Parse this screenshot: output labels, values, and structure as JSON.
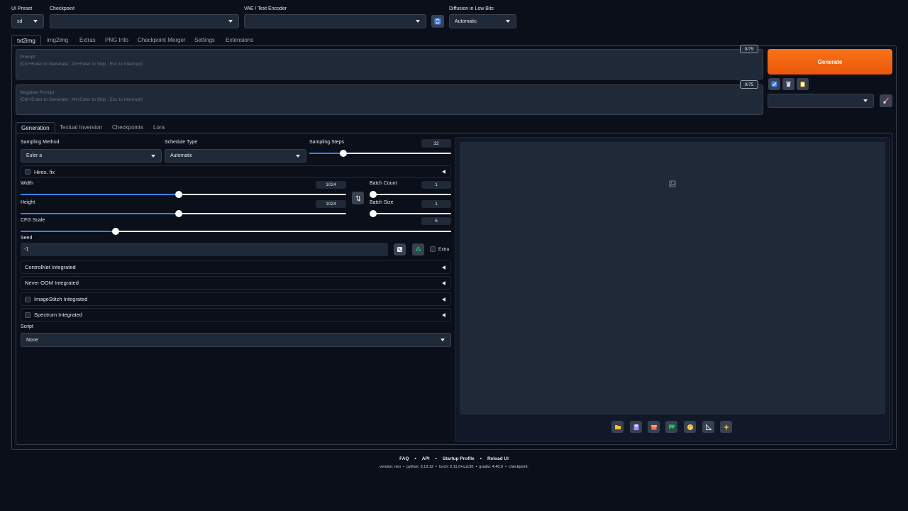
{
  "top": {
    "ui_preset_label": "UI Preset",
    "ui_preset_value": "sd",
    "checkpoint_label": "Checkpoint",
    "checkpoint_value": "",
    "vae_label": "VAE / Text Encoder",
    "vae_value": "",
    "diffusion_label": "Diffusion in Low Bits",
    "diffusion_value": "Automatic"
  },
  "main_tabs": [
    "txt2img",
    "img2img",
    "Extras",
    "PNG Info",
    "Checkpoint Merger",
    "Settings",
    "Extensions"
  ],
  "prompt": {
    "label": "Prompt",
    "hint": "(Ctrl+Enter to Generate ; Alt+Enter to Skip ; Esc to Interrupt)",
    "counter": "0/75"
  },
  "negative_prompt": {
    "label": "Negative Prompt",
    "hint": "(Ctrl+Enter to Generate ; Alt+Enter to Skip ; Esc to Interrupt)",
    "counter": "0/75"
  },
  "generate_label": "Generate",
  "styles_value": "",
  "sub_tabs": [
    "Generation",
    "Textual Inversion",
    "Checkpoints",
    "Lora"
  ],
  "generation": {
    "sampling_method_label": "Sampling Method",
    "sampling_method_value": "Euler a",
    "schedule_type_label": "Schedule Type",
    "schedule_type_value": "Automatic",
    "sampling_steps_label": "Sampling Steps",
    "sampling_steps_value": "32",
    "hires_fix_label": "Hires. fix",
    "width_label": "Width",
    "width_value": "1024",
    "height_label": "Height",
    "height_value": "1024",
    "batch_count_label": "Batch Count",
    "batch_count_value": "1",
    "batch_size_label": "Batch Size",
    "batch_size_value": "1",
    "cfg_scale_label": "CFG Scale",
    "cfg_scale_value": "6",
    "seed_label": "Seed",
    "seed_value": "-1",
    "extra_label": "Extra",
    "accordions": [
      "ControlNet Integrated",
      "Never OOM Integrated",
      "ImageStitch Integrated",
      "Spectrum Integrated"
    ],
    "script_label": "Script",
    "script_value": "None"
  },
  "sliders": {
    "sampling_steps": 0.24,
    "width": 0.485,
    "height": 0.485,
    "batch_count": 0.0,
    "batch_size": 0.0,
    "cfg_scale": 0.22
  },
  "footer": {
    "links": [
      "FAQ",
      "API",
      "Startup Profile",
      "Reload UI"
    ],
    "separator": "•",
    "version_text": "version: neo  •  python: 3.13.12  •  torch: 2.11.0+cu130  •  gradio: 4.40.0  •  checkpoint:"
  },
  "colors": {
    "background": "#0b0f19",
    "panel": "#1f2937",
    "accent_orange": "#ea580c",
    "slider_blue": "#3b82f6"
  }
}
